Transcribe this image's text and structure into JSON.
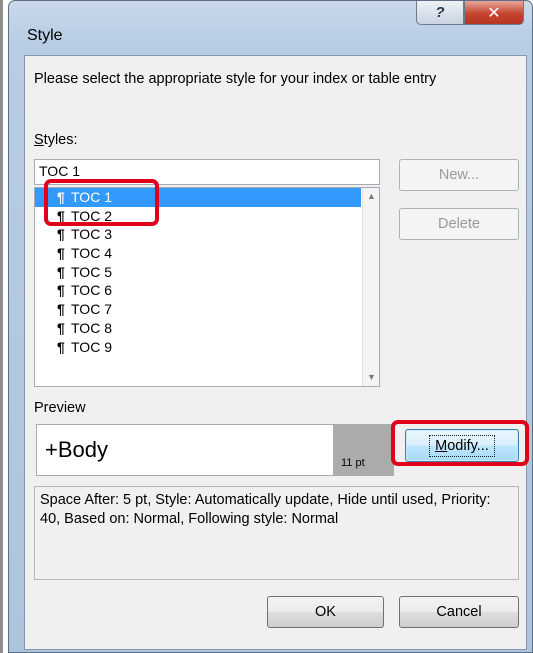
{
  "window": {
    "title": "Style",
    "help_glyph": "?",
    "close_glyph": "✕"
  },
  "dialog": {
    "instruction": "Please select the appropriate style for your index or table entry",
    "styles_label_first": "S",
    "styles_label_rest": "tyles:",
    "style_input_value": "TOC 1",
    "style_list": {
      "items": [
        "TOC 1",
        "TOC 2",
        "TOC 3",
        "TOC 4",
        "TOC 5",
        "TOC 6",
        "TOC 7",
        "TOC 8",
        "TOC 9"
      ],
      "selected": "TOC 1",
      "pilcrow": "¶"
    },
    "buttons": {
      "new": "New...",
      "delete": "Delete",
      "modify_first": "M",
      "modify_rest": "odify...",
      "ok": "OK",
      "cancel": "Cancel"
    },
    "preview_label": "Preview",
    "preview_font": "+Body",
    "preview_size": "11 pt",
    "description": "Space After:  5 pt, Style: Automatically update, Hide until used, Priority: 40, Based on: Normal, Following style: Normal"
  },
  "colors": {
    "highlight": "#e0001b",
    "selection": "#3399ff"
  }
}
